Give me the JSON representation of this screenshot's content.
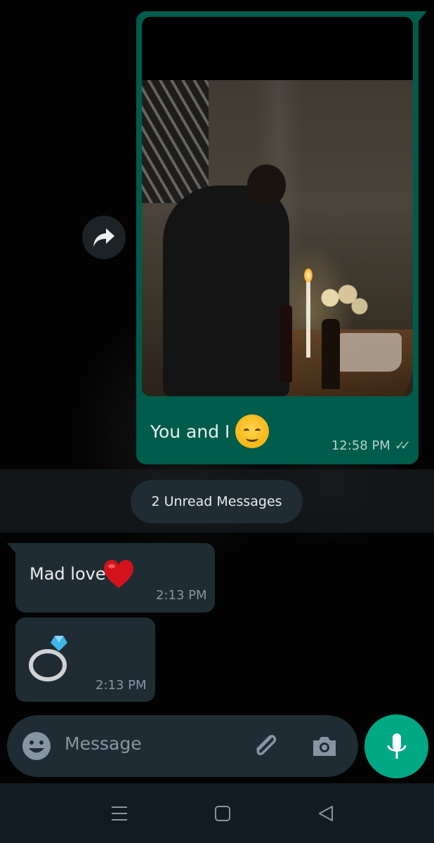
{
  "outgoing": {
    "caption": "You and I",
    "time": "12:58 PM",
    "status": "read",
    "bubble_color": "#005c4b",
    "emoji": "smiling-face-with-rosy-cheeks"
  },
  "forward_icon": "forward-icon",
  "unread_banner": {
    "label": "2 Unread Messages"
  },
  "incoming": [
    {
      "text": "Mad love",
      "emoji": "red-heart",
      "time": "2:13 PM"
    },
    {
      "sticker": "diamond-ring",
      "time": "2:13 PM"
    }
  ],
  "composer": {
    "placeholder": "Message",
    "icons": [
      "emoji-icon",
      "attach-icon",
      "camera-icon",
      "mic-icon"
    ],
    "accent_color": "#00a884"
  },
  "navigation": {
    "icons": [
      "menu-icon",
      "home-icon",
      "back-icon"
    ]
  }
}
